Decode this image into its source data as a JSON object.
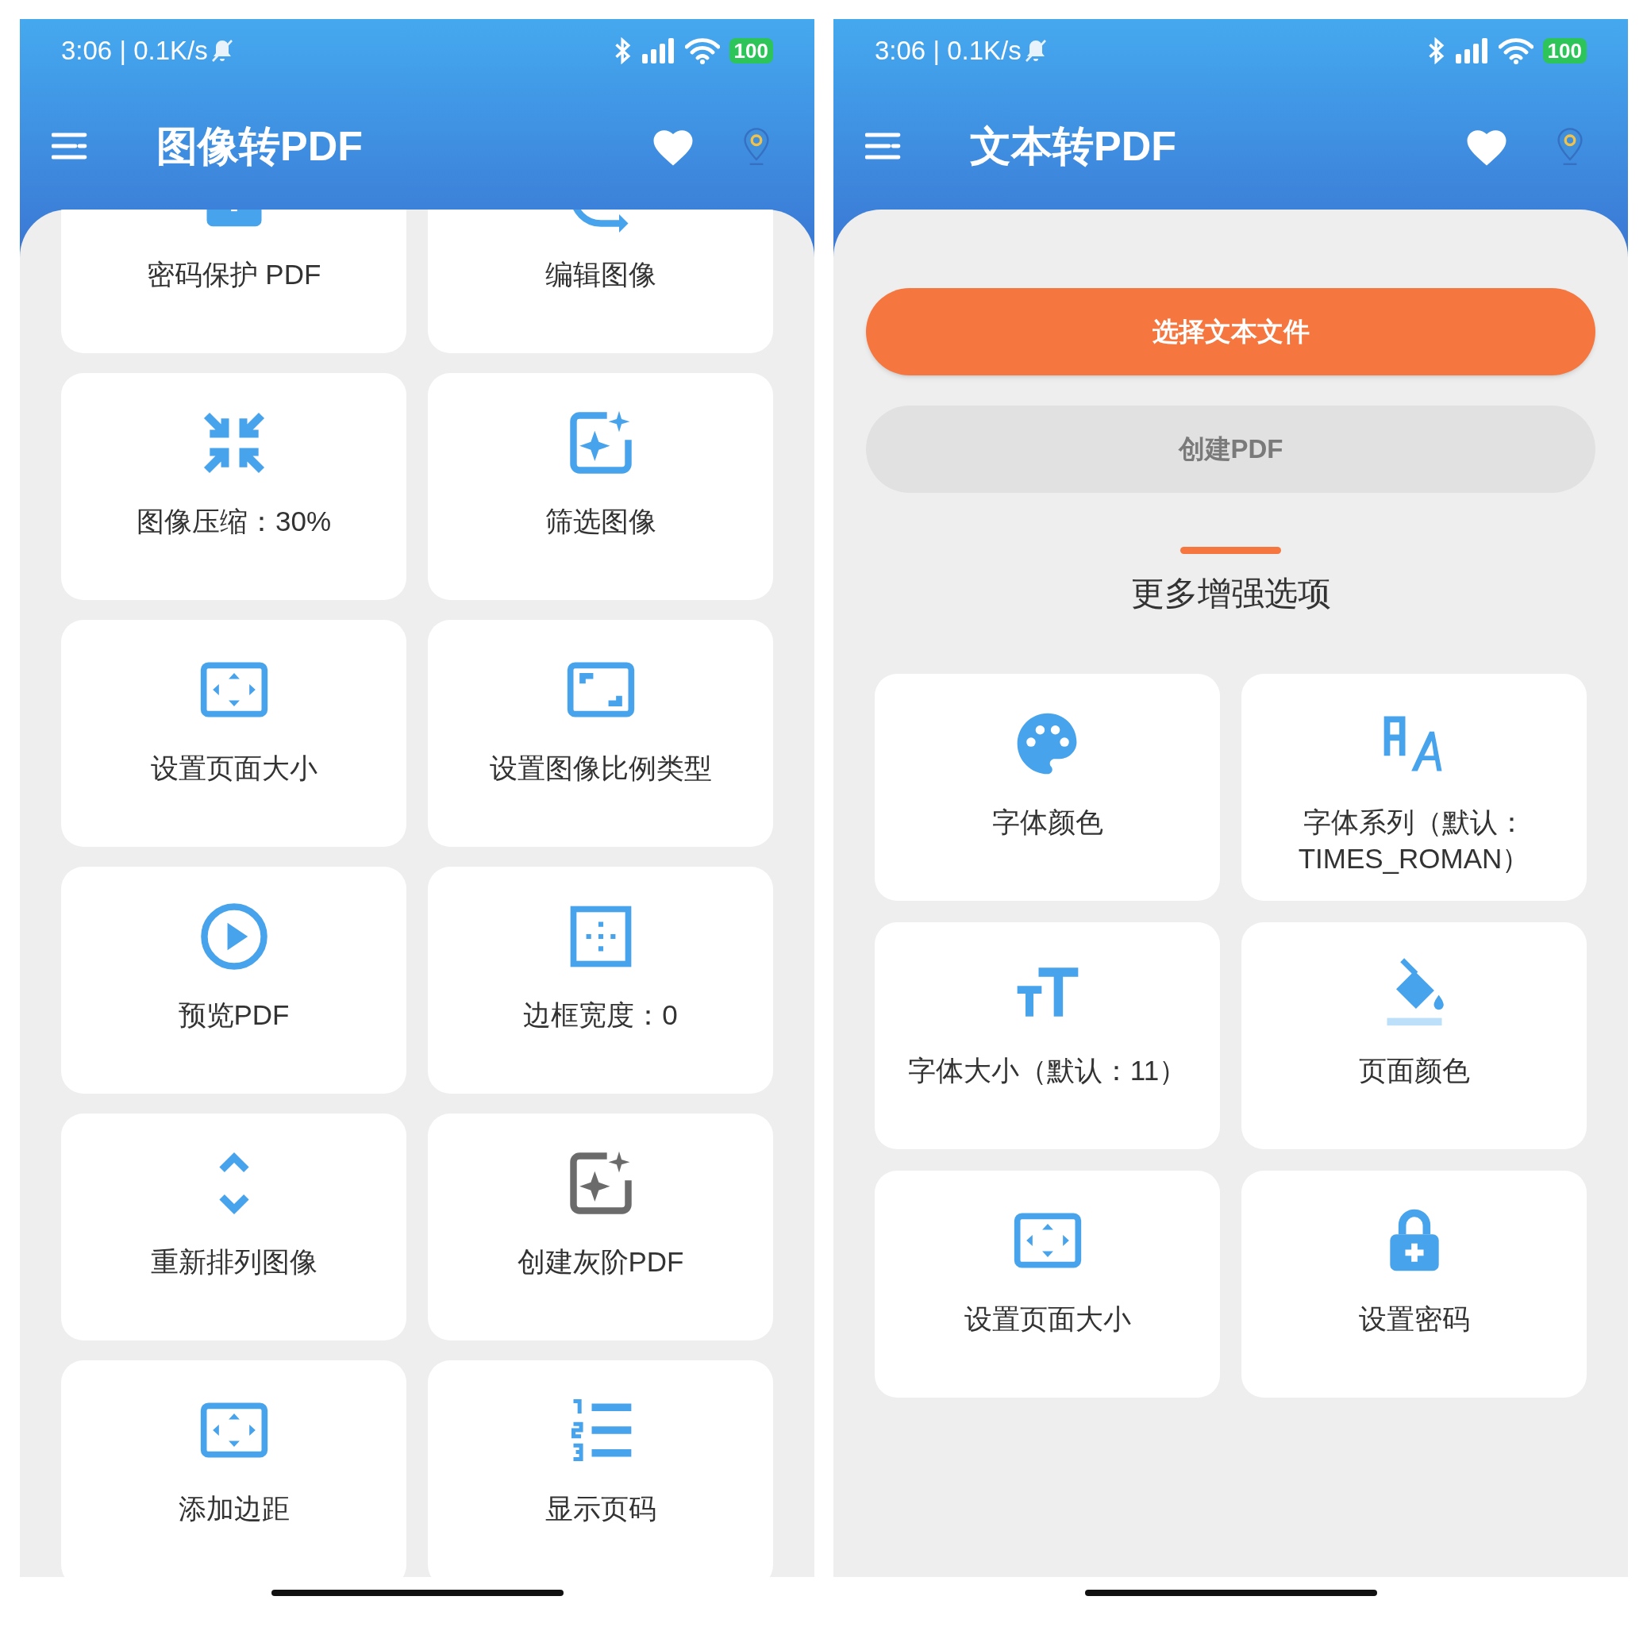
{
  "screens": [
    {
      "status_bar": {
        "time": "3:06 | 0.1K/s",
        "battery": "100"
      },
      "title": "图像转PDF",
      "options": [
        {
          "label": "密码保护 PDF"
        },
        {
          "label": "编辑图像"
        },
        {
          "label": "图像压缩：30%"
        },
        {
          "label": "筛选图像"
        },
        {
          "label": "设置页面大小"
        },
        {
          "label": "设置图像比例类型"
        },
        {
          "label": "预览PDF"
        },
        {
          "label": "边框宽度：0"
        },
        {
          "label": "重新排列图像"
        },
        {
          "label": "创建灰阶PDF"
        },
        {
          "label": "添加边距"
        },
        {
          "label": "显示页码"
        }
      ]
    },
    {
      "status_bar": {
        "time": "3:06 | 0.1K/s",
        "battery": "100"
      },
      "title": "文本转PDF",
      "buttons": [
        {
          "label": "选择文本文件",
          "disabled": false
        },
        {
          "label": "创建PDF",
          "disabled": true
        }
      ],
      "section_title": "更多增强选项",
      "options": [
        {
          "label": "字体颜色"
        },
        {
          "label": "字体系列（默认：TIMES_ROMAN）"
        },
        {
          "label": "字体大小（默认：11）"
        },
        {
          "label": "页面颜色"
        },
        {
          "label": "设置页面大小"
        },
        {
          "label": "设置密码"
        }
      ]
    }
  ]
}
